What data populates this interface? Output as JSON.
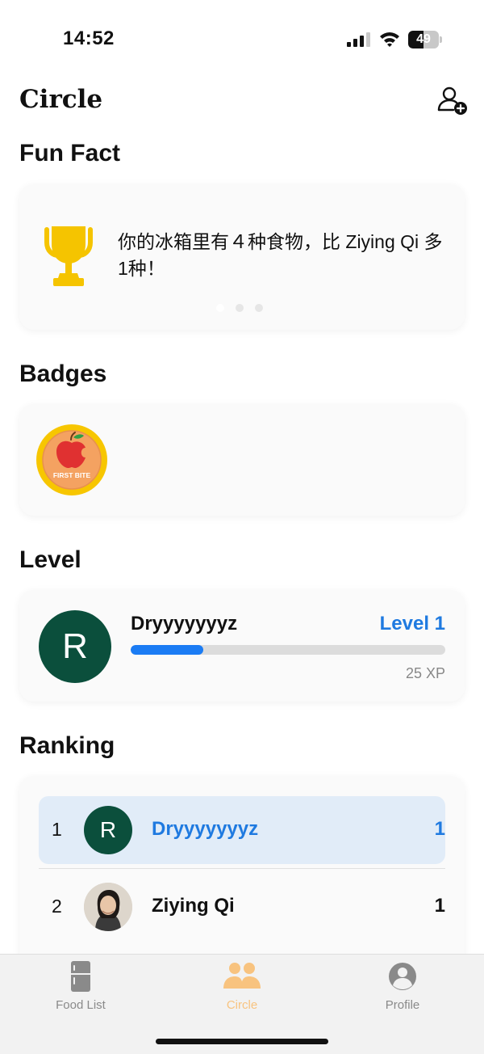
{
  "status_bar": {
    "time": "14:52",
    "battery": "49",
    "battery_level": 0.49
  },
  "header": {
    "title": "Circle",
    "add_friend_icon": "person-add-icon"
  },
  "fun_fact": {
    "section_title": "Fun Fact",
    "icon": "trophy-icon",
    "text": "你的冰箱里有４种食物，比 Ziying Qi 多1种！",
    "pager": {
      "count": 3,
      "active_index": 0
    }
  },
  "badges": {
    "section_title": "Badges",
    "items": [
      {
        "label": "FIRST BITE",
        "icon": "apple-badge-icon"
      }
    ]
  },
  "level": {
    "section_title": "Level",
    "avatar_letter": "R",
    "username": "Dryyyyyyyz",
    "level_label": "Level 1",
    "progress": 0.23,
    "xp": "25 XP"
  },
  "ranking": {
    "section_title": "Ranking",
    "rows": [
      {
        "rank": "1",
        "avatar_letter": "R",
        "name": "Dryyyyyyyz",
        "score": "1",
        "is_current_user": true
      },
      {
        "rank": "2",
        "avatar_letter": "",
        "name": "Ziying Qi",
        "score": "1",
        "is_current_user": false
      }
    ]
  },
  "tab_bar": {
    "tabs": [
      {
        "label": "Food List",
        "icon": "fridge-icon",
        "active": false
      },
      {
        "label": "Circle",
        "icon": "people-icon",
        "active": true
      },
      {
        "label": "Profile",
        "icon": "profile-icon",
        "active": false
      }
    ],
    "active_color": "#f8c37f",
    "inactive_color": "#8a8a8a"
  },
  "colors": {
    "accent_blue": "#1f7ae0",
    "avatar_green": "#0b4f3c",
    "trophy_gold": "#f5c400",
    "highlight_row": "#e1ecf8"
  }
}
